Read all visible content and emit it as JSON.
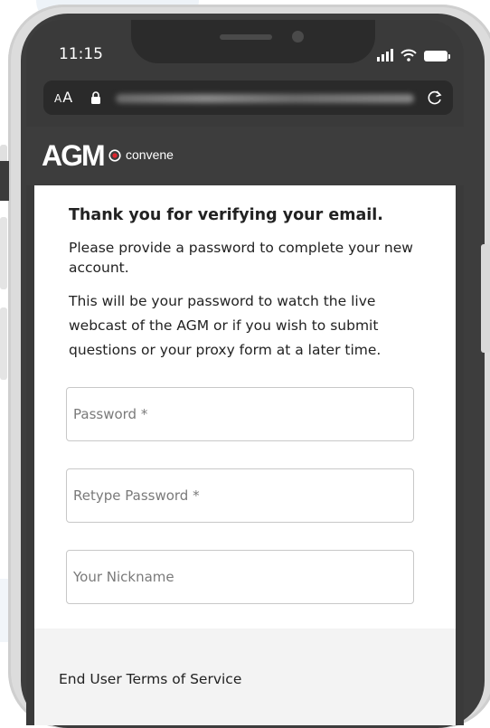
{
  "status_bar": {
    "time": "11:15",
    "icons": [
      "signal-icon",
      "wifi-icon",
      "battery-icon"
    ]
  },
  "browser": {
    "text_size_label": "AA",
    "url": "",
    "icons": [
      "lock-icon",
      "reload-icon"
    ]
  },
  "app_header": {
    "logo_text": "AGM",
    "brand_text": "convene"
  },
  "main": {
    "heading": "Thank you for verifying your email.",
    "instruction": "Please provide a password to complete your new account.",
    "description": "This will be your password to watch the live webcast of the AGM or if you wish to submit questions or your proxy form at a later time.",
    "fields": [
      {
        "placeholder": "Password *",
        "value": ""
      },
      {
        "placeholder": "Retype Password *",
        "value": ""
      },
      {
        "placeholder": "Your Nickname",
        "value": ""
      }
    ]
  },
  "footer": {
    "terms_link": "End User Terms of Service"
  },
  "colors": {
    "header_bg": "#3d3d3d",
    "page_bg": "#ffffff",
    "footer_bg": "#f3f3f3",
    "brand_red": "#e0252d"
  }
}
